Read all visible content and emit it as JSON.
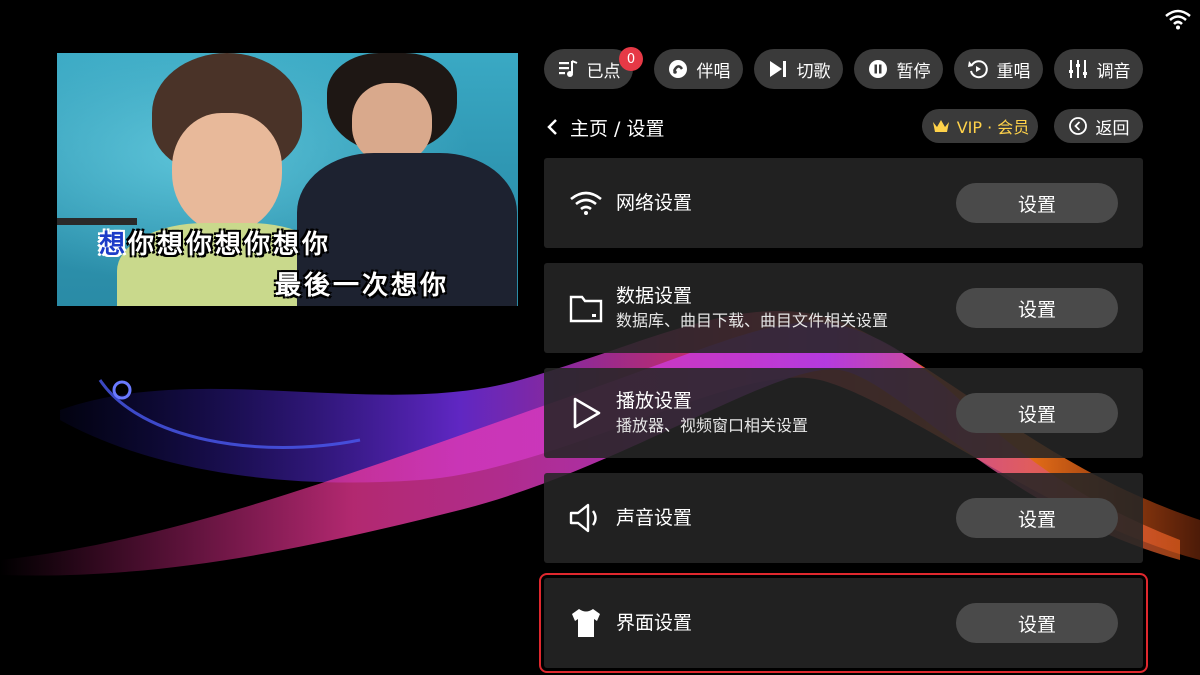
{
  "controls": {
    "ordered": {
      "label": "已点",
      "count": "0"
    },
    "accompany": {
      "label": "伴唱"
    },
    "skip": {
      "label": "切歌"
    },
    "pause": {
      "label": "暂停"
    },
    "replay": {
      "label": "重唱"
    },
    "tuning": {
      "label": "调音"
    }
  },
  "breadcrumb": {
    "text": "主页 / 设置"
  },
  "vip": {
    "label": "VIP · 会员"
  },
  "back": {
    "label": "返回"
  },
  "video": {
    "lyric_line_1_sung": "想",
    "lyric_line_1_rest": "你想你想你想你",
    "lyric_line_2": "最後一次想你"
  },
  "settings": [
    {
      "title": "网络设置",
      "subtitle": "",
      "button": "设置",
      "icon": "wifi-icon"
    },
    {
      "title": "数据设置",
      "subtitle": "数据库、曲目下载、曲目文件相关设置",
      "button": "设置",
      "icon": "folder-icon"
    },
    {
      "title": "播放设置",
      "subtitle": "播放器、视频窗口相关设置",
      "button": "设置",
      "icon": "play-icon"
    },
    {
      "title": "声音设置",
      "subtitle": "",
      "button": "设置",
      "icon": "speaker-icon"
    },
    {
      "title": "界面设置",
      "subtitle": "",
      "button": "设置",
      "icon": "tshirt-icon"
    }
  ],
  "selected_setting": "界面设置",
  "colors": {
    "accent_vip": "#ffd24a",
    "badge": "#e63946",
    "selection": "#e0282e",
    "button_bg": "#3a3a3a"
  }
}
